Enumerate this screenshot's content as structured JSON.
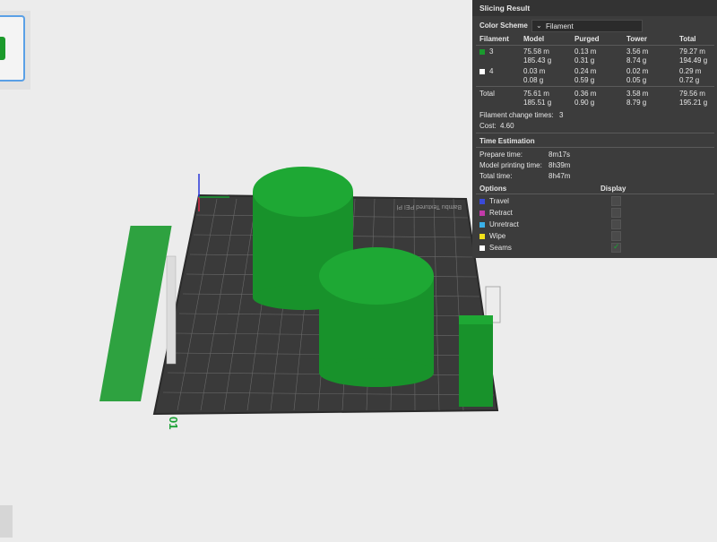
{
  "panel": {
    "title": "Slicing Result",
    "color_scheme_label": "Color Scheme",
    "color_scheme_value": "Filament",
    "columns": [
      "Filament",
      "Model",
      "Purged",
      "Tower",
      "Total"
    ],
    "rows": [
      {
        "id": "3",
        "color": "#1a9a2e",
        "model_len": "75.58 m",
        "model_wt": "185.43 g",
        "purged_len": "0.13 m",
        "purged_wt": "0.31 g",
        "tower_len": "3.56 m",
        "tower_wt": "8.74 g",
        "total_len": "79.27 m",
        "total_wt": "194.49 g"
      },
      {
        "id": "4",
        "color": "#ffffff",
        "model_len": "0.03 m",
        "model_wt": "0.08 g",
        "purged_len": "0.24 m",
        "purged_wt": "0.59 g",
        "tower_len": "0.02 m",
        "tower_wt": "0.05 g",
        "total_len": "0.29 m",
        "total_wt": "0.72 g"
      }
    ],
    "total": {
      "label": "Total",
      "model_len": "75.61 m",
      "model_wt": "185.51 g",
      "purged_len": "0.36 m",
      "purged_wt": "0.90 g",
      "tower_len": "3.58 m",
      "tower_wt": "8.79 g",
      "total_len": "79.56 m",
      "total_wt": "195.21 g"
    },
    "filament_change_label": "Filament change times:",
    "filament_change_value": "3",
    "cost_label": "Cost:",
    "cost_value": "4.60",
    "time_title": "Time Estimation",
    "prepare_label": "Prepare time:",
    "prepare_value": "8m17s",
    "model_time_label": "Model printing time:",
    "model_time_value": "8h39m",
    "total_time_label": "Total time:",
    "total_time_value": "8h47m",
    "options_label": "Options",
    "display_label": "Display",
    "options": [
      {
        "label": "Travel",
        "color": "#3a4ad8",
        "checked": false
      },
      {
        "label": "Retract",
        "color": "#c23aa8",
        "checked": false
      },
      {
        "label": "Unretract",
        "color": "#3ab0e8",
        "checked": false
      },
      {
        "label": "Wipe",
        "color": "#f2e21a",
        "checked": false
      },
      {
        "label": "Seams",
        "color": "#ffffff",
        "checked": true
      }
    ]
  },
  "plate": {
    "label_text": "Bambu Textured PEI Pl",
    "plate_number": "01"
  },
  "colors": {
    "model_green": "#1a9a2e",
    "plate_dark": "#3a3a3a",
    "panel_bg": "#3c3c3c"
  }
}
